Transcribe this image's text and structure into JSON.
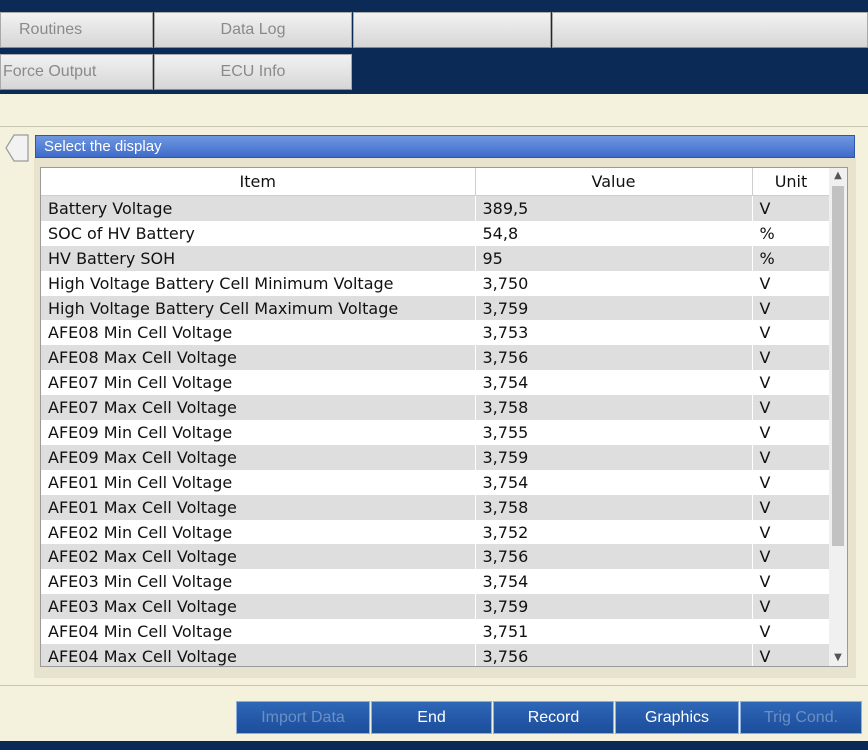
{
  "tabs": {
    "routines": "Routines",
    "data_log": "Data Log",
    "force_output": "Force Output",
    "ecu_info": "ECU Info"
  },
  "display_header": "Select the display",
  "table": {
    "columns": [
      "Item",
      "Value",
      "Unit"
    ],
    "rows": [
      [
        "Battery Voltage",
        "389,5",
        "V"
      ],
      [
        "SOC of HV Battery",
        "54,8",
        "%"
      ],
      [
        "HV Battery SOH",
        "95",
        "%"
      ],
      [
        "High Voltage Battery Cell Minimum Voltage",
        "3,750",
        "V"
      ],
      [
        "High Voltage Battery Cell Maximum Voltage",
        "3,759",
        "V"
      ],
      [
        "AFE08 Min Cell Voltage",
        "3,753",
        "V"
      ],
      [
        "AFE08 Max Cell Voltage",
        "3,756",
        "V"
      ],
      [
        "AFE07 Min Cell Voltage",
        "3,754",
        "V"
      ],
      [
        "AFE07 Max Cell Voltage",
        "3,758",
        "V"
      ],
      [
        "AFE09 Min Cell Voltage",
        "3,755",
        "V"
      ],
      [
        "AFE09 Max Cell Voltage",
        "3,759",
        "V"
      ],
      [
        "AFE01 Min Cell Voltage",
        "3,754",
        "V"
      ],
      [
        "AFE01 Max Cell Voltage",
        "3,758",
        "V"
      ],
      [
        "AFE02 Min Cell Voltage",
        "3,752",
        "V"
      ],
      [
        "AFE02 Max Cell Voltage",
        "3,756",
        "V"
      ],
      [
        "AFE03 Min Cell Voltage",
        "3,754",
        "V"
      ],
      [
        "AFE03 Max Cell Voltage",
        "3,759",
        "V"
      ],
      [
        "AFE04 Min Cell Voltage",
        "3,751",
        "V"
      ],
      [
        "AFE04 Max Cell Voltage",
        "3,756",
        "V"
      ]
    ]
  },
  "buttons": {
    "import_data": "Import Data",
    "end": "End",
    "record": "Record",
    "graphics": "Graphics",
    "trig_cond": "Trig Cond."
  },
  "icons": {
    "back": "back-arrow-icon",
    "scroll_up": "chevron-up-icon",
    "scroll_down": "chevron-down-icon"
  },
  "colors": {
    "navy": "#0b2a55",
    "header_blue": "#3f6ccb",
    "button_blue": "#1b4d9a",
    "row_alt": "#dedede"
  }
}
